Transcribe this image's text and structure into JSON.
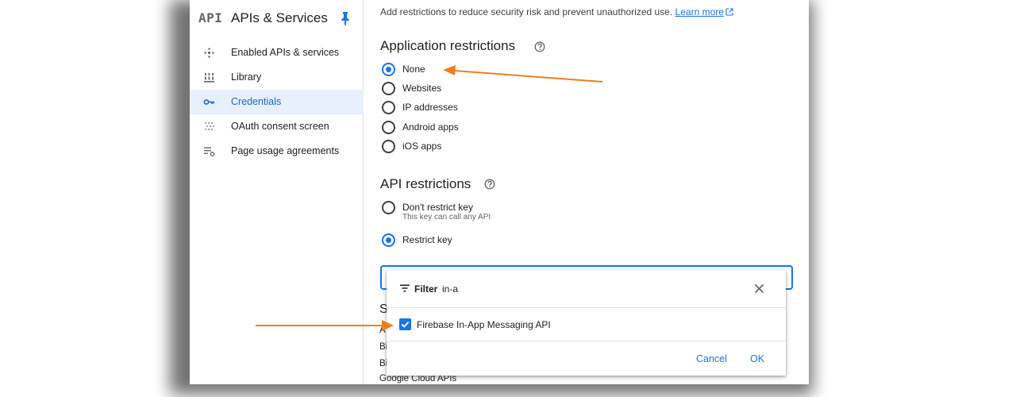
{
  "sidebar": {
    "logo": "API",
    "title": "APIs & Services",
    "items": [
      {
        "label": "Enabled APIs & services",
        "icon": "enabled-apis-icon"
      },
      {
        "label": "Library",
        "icon": "library-icon"
      },
      {
        "label": "Credentials",
        "icon": "key-icon",
        "active": true
      },
      {
        "label": "OAuth consent screen",
        "icon": "oauth-consent-icon"
      },
      {
        "label": "Page usage agreements",
        "icon": "agreements-icon"
      }
    ]
  },
  "main": {
    "intro_text": "Add restrictions to reduce security risk and prevent unauthorized use.",
    "learn_more": "Learn more",
    "application_restrictions": {
      "title": "Application restrictions",
      "options": [
        {
          "label": "None",
          "checked": true
        },
        {
          "label": "Websites",
          "checked": false
        },
        {
          "label": "IP addresses",
          "checked": false
        },
        {
          "label": "Android apps",
          "checked": false
        },
        {
          "label": "iOS apps",
          "checked": false
        }
      ]
    },
    "api_restrictions": {
      "title": "API restrictions",
      "options": [
        {
          "label": "Don't restrict key",
          "sub": "This key can call any API",
          "checked": false
        },
        {
          "label": "Restrict key",
          "checked": true
        }
      ]
    },
    "behind_dropdown": {
      "heading_char": "S",
      "line1": "A",
      "line2": "Bi",
      "line3": "Bi",
      "line4": "Google Cloud APIs"
    }
  },
  "dropdown": {
    "filter_label": "Filter",
    "filter_value": "in-a",
    "option": {
      "label": "Firebase In-App Messaging API",
      "checked": true
    },
    "cancel_label": "Cancel",
    "ok_label": "OK"
  },
  "colors": {
    "accent": "#1a73e8",
    "active_bg": "#e8f0fe",
    "annotation_arrow": "#f07d20"
  }
}
